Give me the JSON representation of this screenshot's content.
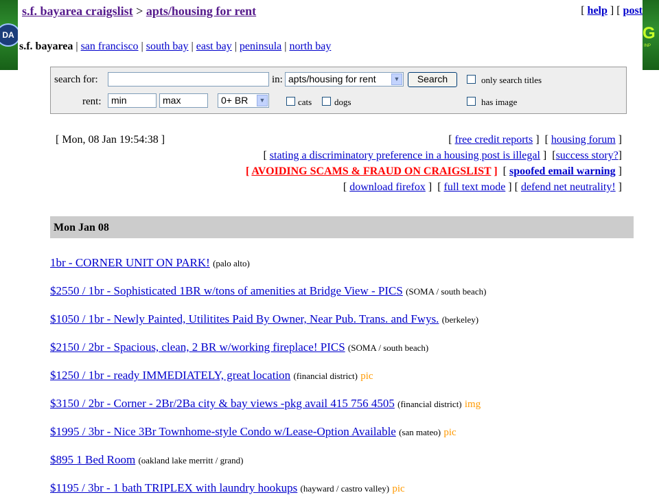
{
  "slide": {
    "left_logo": "DA",
    "right_logo": "G",
    "right_logo_sub": "INP"
  },
  "breadcrumb": {
    "site": "s.f. bayarea craigslist",
    "separator": ">",
    "section": "apts/housing for rent"
  },
  "top_links": {
    "open1": "[",
    "help": "help",
    "mid": "] [",
    "post": "post"
  },
  "subnav": {
    "current": "s.f. bayarea",
    "areas": [
      "san francisco",
      "south bay",
      "east bay",
      "peninsula",
      "north bay"
    ]
  },
  "search": {
    "search_for_label": "search for:",
    "search_value": "",
    "in_label": "in:",
    "category": "apts/housing for rent",
    "button": "Search",
    "only_titles": "only search titles",
    "rent_label": "rent:",
    "min": "min",
    "max": "max",
    "bedrooms": "0+ BR",
    "cats": "cats",
    "dogs": "dogs",
    "has_image": "has image"
  },
  "timestamp": "[ Mon, 08 Jan 19:54:38 ]",
  "links": {
    "free_credit": "free credit reports",
    "housing_forum": "housing forum",
    "discriminatory": "stating a discriminatory preference in a housing post is illegal",
    "success_story": "success story?",
    "scams": "AVOIDING SCAMS & FRAUD ON CRAIGSLIST",
    "spoofed": "spoofed email warning",
    "firefox": "download firefox",
    "full_text": "full text mode",
    "neutrality": "defend net neutrality!"
  },
  "day_header": "Mon Jan 08",
  "listings": [
    {
      "title": "1br - CORNER UNIT ON PARK!",
      "location": "(palo alto)",
      "tag": ""
    },
    {
      "title": "$2550 / 1br - Sophisticated 1BR w/tons of amenities at Bridge View - PICS",
      "location": "(SOMA / south beach)",
      "tag": ""
    },
    {
      "title": "$1050 / 1br - Newly Painted, Utilitites Paid By Owner, Near Pub. Trans. and Fwys.",
      "location": "(berkeley)",
      "tag": ""
    },
    {
      "title": "$2150 / 2br - Spacious, clean, 2 BR w/working fireplace! PICS",
      "location": "(SOMA / south beach)",
      "tag": ""
    },
    {
      "title": "$1250 / 1br - ready IMMEDIATELY, great location",
      "location": "(financial district)",
      "tag": "pic"
    },
    {
      "title": "$3150 / 2br - Corner - 2Br/2Ba city & bay views -pkg avail 415 756 4505",
      "location": "(financial district)",
      "tag": "img"
    },
    {
      "title": "$1995 / 3br - Nice 3Br Townhome-style Condo w/Lease-Option Available",
      "location": "(san mateo)",
      "tag": "pic"
    },
    {
      "title": "$895 1 Bed Room",
      "location": "(oakland lake merritt / grand)",
      "tag": ""
    },
    {
      "title": "$1195 / 3br - 1 bath TRIPLEX with laundry hookups",
      "location": "(hayward / castro valley)",
      "tag": "pic"
    }
  ]
}
